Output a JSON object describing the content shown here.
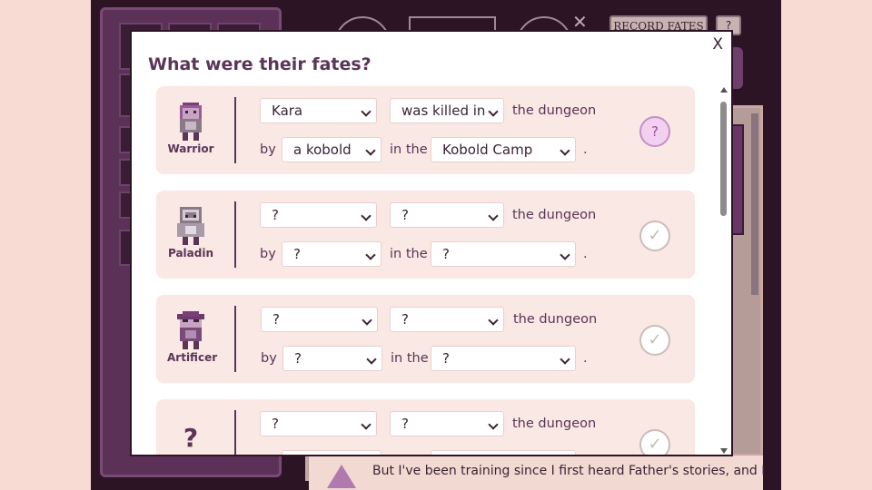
{
  "header": {
    "record_fates_label": "RECORD FATES",
    "help_label": "?"
  },
  "story": {
    "text": "But I've been training since I first heard Father's stories, and I"
  },
  "modal": {
    "title": "What were their fates?",
    "close_label": "X",
    "labels": {
      "the_dungeon": "the dungeon",
      "by": "by",
      "in_the": "in the",
      "period": "."
    },
    "entries": [
      {
        "class_name": "Warrior",
        "name": "Kara",
        "fate": "was killed in",
        "killer": "a kobold",
        "location": "Kobold Camp",
        "status": "?",
        "status_icon": "question-icon"
      },
      {
        "class_name": "Paladin",
        "name": "?",
        "fate": "?",
        "killer": "?",
        "location": "?",
        "status": "✓",
        "status_icon": "check-icon"
      },
      {
        "class_name": "Artificer",
        "name": "?",
        "fate": "?",
        "killer": "?",
        "location": "?",
        "status": "✓",
        "status_icon": "check-icon"
      },
      {
        "class_name": "?",
        "name": "?",
        "fate": "?",
        "killer": "",
        "location": "",
        "status": "✓",
        "status_icon": "check-icon"
      }
    ]
  },
  "colors": {
    "page_bg": "#f8dcd4",
    "modal_bg": "#ffffff",
    "card_bg": "#f9e8e3",
    "title_text": "#5a3558",
    "pending_badge": "#f2d0f0"
  },
  "icons": [
    "fullscreen-icon",
    "close-icon",
    "chevron-down-icon",
    "check-icon",
    "question-icon"
  ]
}
